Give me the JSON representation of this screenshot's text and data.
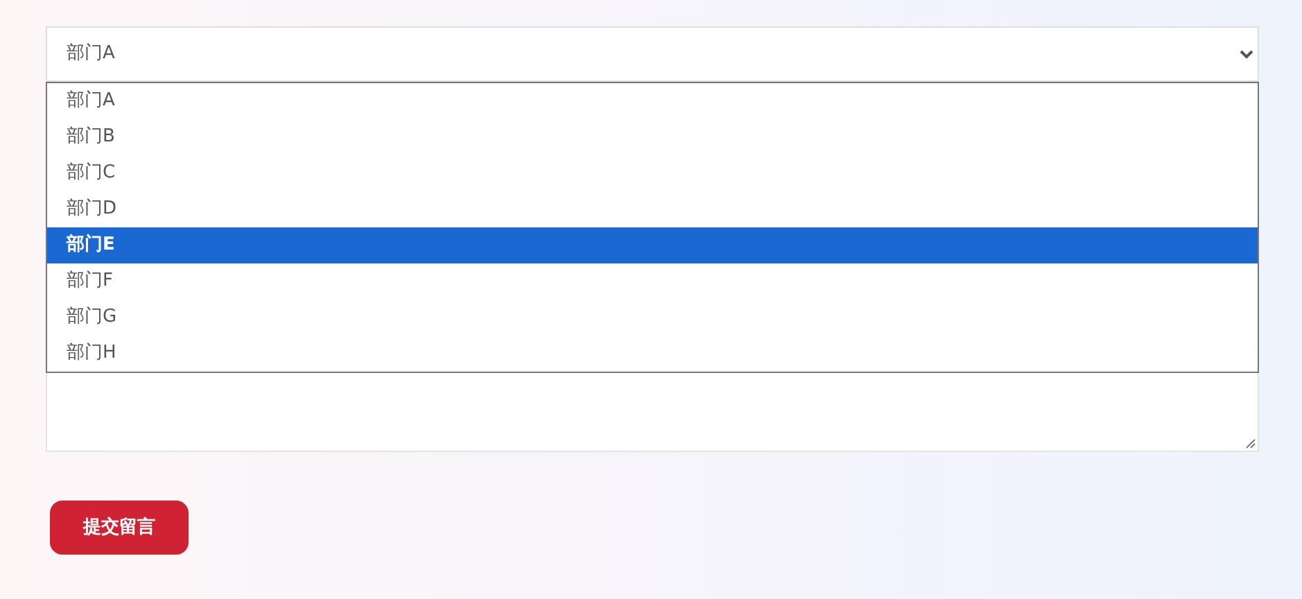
{
  "department_select": {
    "value": "部门A",
    "expanded": true,
    "options": [
      {
        "label": "部门A",
        "highlighted": false
      },
      {
        "label": "部门B",
        "highlighted": false
      },
      {
        "label": "部门C",
        "highlighted": false
      },
      {
        "label": "部门D",
        "highlighted": false
      },
      {
        "label": "部门E",
        "highlighted": true
      },
      {
        "label": "部门F",
        "highlighted": false
      },
      {
        "label": "部门G",
        "highlighted": false
      },
      {
        "label": "部门H",
        "highlighted": false
      }
    ]
  },
  "submit_button": "提交留言"
}
